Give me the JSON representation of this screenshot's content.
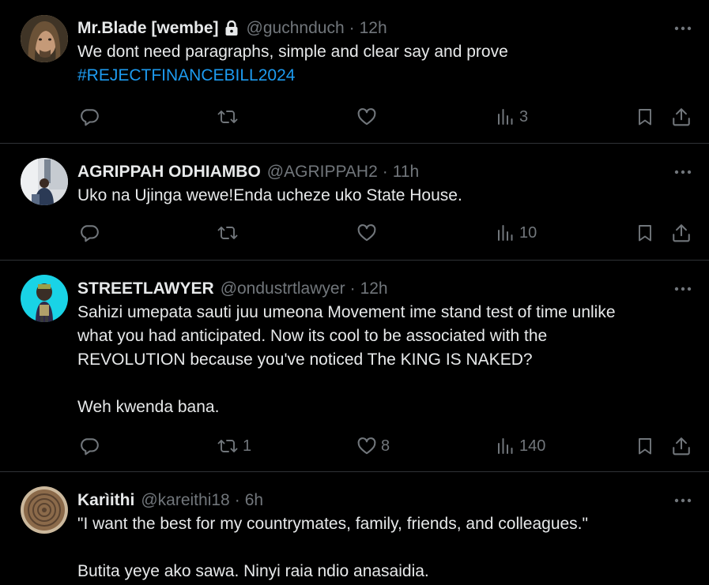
{
  "colors": {
    "background": "#000000",
    "text": "#e7e9ea",
    "muted": "#71767b",
    "link": "#1d9bf0",
    "divider": "#2f3336"
  },
  "tweets": [
    {
      "name": "Mr.Blade [wembe]",
      "protected_icon": "lock-icon",
      "handle": "@guchnduch",
      "dot": "·",
      "time": "12h",
      "lines": [
        "We dont need paragraphs, simple and clear say and prove"
      ],
      "hashtag": "#REJECTFINANCEBILL2024",
      "reply_count": "",
      "retweet_count": "",
      "like_count": "",
      "view_count": "3"
    },
    {
      "name": "AGRIPPAH ODHIAMBO",
      "handle": "@AGRIPPAH2",
      "dot": "·",
      "time": "11h",
      "lines": [
        "Uko na Ujinga wewe!Enda ucheze uko State House."
      ],
      "reply_count": "",
      "retweet_count": "",
      "like_count": "",
      "view_count": "10"
    },
    {
      "name": "STREETLAWYER",
      "handle": "@ondustrtlawyer",
      "dot": "·",
      "time": "12h",
      "lines": [
        "Sahizi umepata sauti juu umeona Movement ime stand test of time unlike",
        "what you had anticipated. Now its cool to be associated with the",
        "REVOLUTION because you've noticed The KING IS NAKED?",
        "Weh kwenda bana."
      ],
      "reply_count": "",
      "retweet_count": "1",
      "like_count": "8",
      "view_count": "140"
    },
    {
      "name": "Karìithi",
      "handle": "@kareithi18",
      "dot": "·",
      "time": "6h",
      "lines": [
        "\"I want the best for my countrymates, family, friends, and colleagues.\"",
        "Butita yeye ako sawa. Ninyi raia ndio anasaidia."
      ]
    }
  ]
}
